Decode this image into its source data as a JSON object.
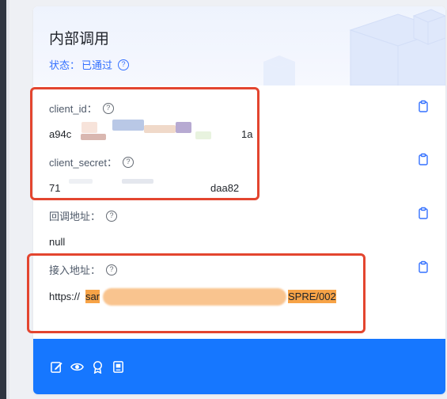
{
  "card": {
    "title": "内部调用",
    "status_label": "状态：",
    "status_value": "已通过",
    "help_glyph": "?"
  },
  "fields": [
    {
      "label": "client_id：",
      "value_start": "a94c",
      "value_end": "1a",
      "icon": "copy-icon"
    },
    {
      "label": "client_secret：",
      "value_start": "71",
      "value_end": "daa82",
      "icon": "copy-icon"
    },
    {
      "label": "回调地址：",
      "value": "null",
      "icon": "copy-icon"
    },
    {
      "label": "接入地址：",
      "value_start": "https://",
      "value_hl_start": "sar",
      "value_hl_end": "SPRE/002",
      "icon": "copy-icon"
    }
  ],
  "actions": [
    "edit-icon",
    "view-icon",
    "badge-icon",
    "document-icon"
  ],
  "colors": {
    "accent": "#3370ff",
    "action_bar": "#1677ff",
    "highlight": "#f7a347",
    "annotation": "#e3452f"
  }
}
